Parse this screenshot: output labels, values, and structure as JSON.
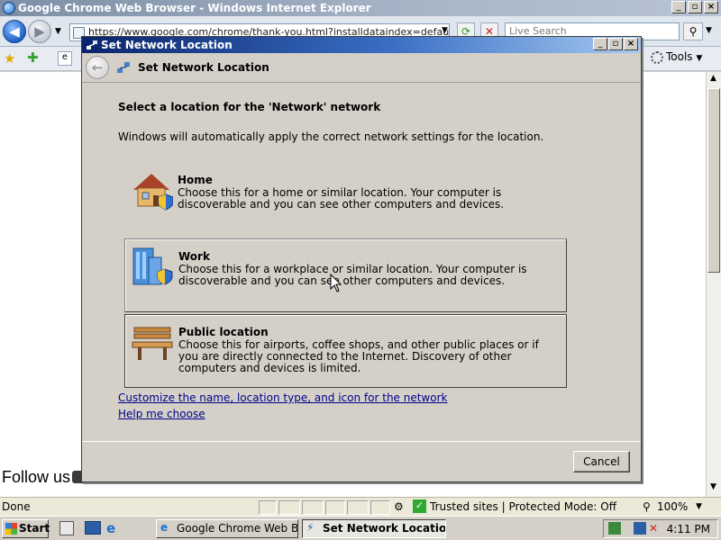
{
  "ie": {
    "title": "Google Chrome Web Browser - Windows Internet Explorer",
    "address": "https://www.google.com/chrome/thank-you.html?installdataindex=defaultbrowser",
    "search_placeholder": "Live Search",
    "tools_label": "Tools",
    "page_text": "Follow us",
    "status": {
      "left": "Done",
      "zone": "Trusted sites | Protected Mode: Off",
      "zoom": "100%"
    }
  },
  "taskbar": {
    "start_label": "Start",
    "tasks": [
      {
        "label": "Google Chrome Web Bro..."
      },
      {
        "label": "Set Network Location"
      }
    ],
    "clock": "4:11 PM"
  },
  "dialog": {
    "window_title": "Set Network Location",
    "header_title": "Set Network Location",
    "heading": "Select a location for the 'Network' network",
    "intro": "Windows will automatically apply the correct network settings for the location.",
    "options": [
      {
        "label": "Home",
        "description": "Choose this for a home or similar location. Your computer is discoverable and you can see other computers and devices.",
        "icon": "house-icon"
      },
      {
        "label": "Work",
        "description": "Choose this for a workplace or similar location. Your computer is discoverable and you can see other computers and devices.",
        "icon": "office-building-icon"
      },
      {
        "label": "Public location",
        "description": "Choose this for airports, coffee shops, and other public places or if you are directly connected to the Internet. Discovery of other computers and devices is limited.",
        "icon": "park-bench-icon"
      }
    ],
    "links": {
      "customize": "Customize the name, location type, and icon for the network",
      "help": "Help me choose"
    },
    "cancel_label": "Cancel"
  }
}
